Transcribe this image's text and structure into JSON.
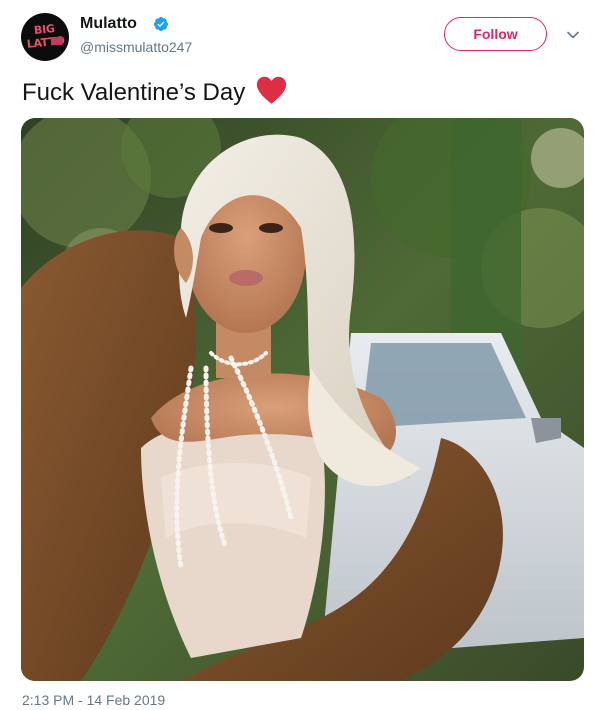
{
  "tweet": {
    "author": {
      "display_name": "Mulatto",
      "handle": "@missmulatto247",
      "verified": true,
      "avatar_text": "BIG LATTO"
    },
    "follow_label": "Follow",
    "text": "Fuck Valentine’s Day",
    "emoji": "heart-icon",
    "timestamp": "2:13 PM - 14 Feb 2019",
    "media": {
      "alt": "photo"
    }
  },
  "colors": {
    "accent_follow": "#e0245e",
    "verified_blue": "#1da1f2",
    "heart_red": "#dd2e44",
    "secondary_text": "#657786",
    "primary_text": "#14171a"
  }
}
